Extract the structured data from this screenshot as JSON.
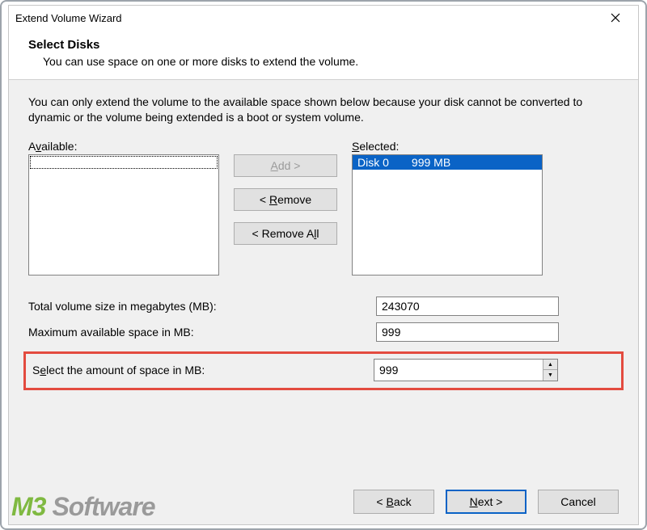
{
  "window": {
    "title": "Extend Volume Wizard"
  },
  "header": {
    "title": "Select Disks",
    "desc": "You can use space on one or more disks to extend the volume."
  },
  "info_text": "You can only extend the volume to the available space shown below because your disk cannot be converted to dynamic or the volume being extended is a boot or system volume.",
  "labels": {
    "available": "Available:",
    "selected": "Selected:",
    "add": "Add >",
    "remove": "< Remove",
    "remove_all": "< Remove All",
    "total_size": "Total volume size in megabytes (MB):",
    "max_space": "Maximum available space in MB:",
    "select_amount": "Select the amount of space in MB:",
    "back": "< Back",
    "next": "Next >",
    "cancel": "Cancel"
  },
  "selected_list": [
    {
      "disk": "Disk 0",
      "size": "999 MB"
    }
  ],
  "values": {
    "total_size": "243070",
    "max_space": "999",
    "select_amount": "999"
  },
  "logo": {
    "left": "M3",
    "right": "Software"
  }
}
